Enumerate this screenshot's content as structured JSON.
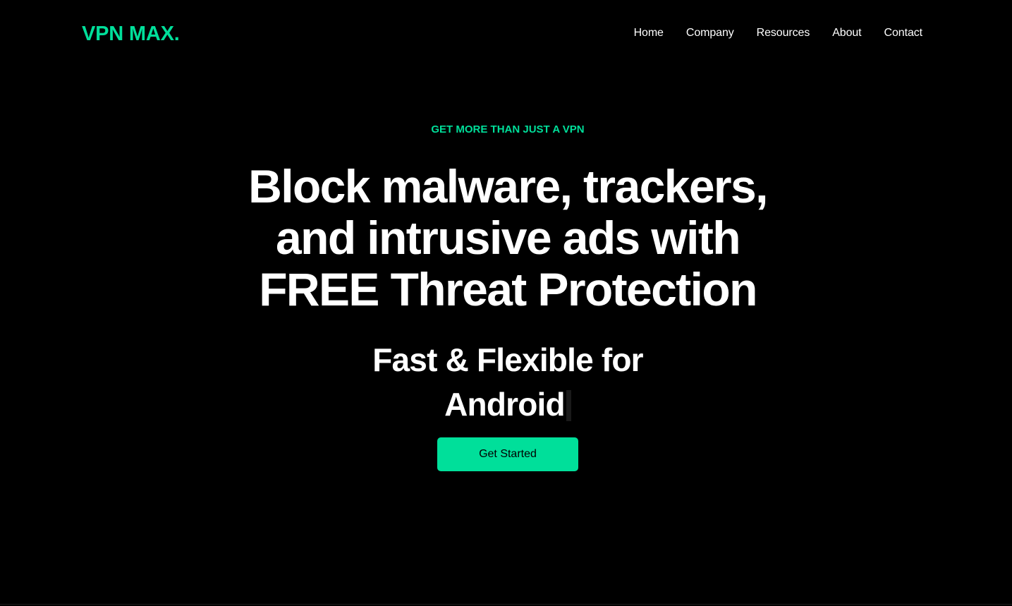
{
  "brand": {
    "logo_text": "VPN MAX.",
    "accent_color": "#00df9a",
    "background_color": "#000000"
  },
  "nav": {
    "items": [
      {
        "label": "Home"
      },
      {
        "label": "Company"
      },
      {
        "label": "Resources"
      },
      {
        "label": "About"
      },
      {
        "label": "Contact"
      }
    ]
  },
  "hero": {
    "eyebrow": "GET MORE THAN JUST A VPN",
    "headline_lines": [
      "Block malware, trackers,",
      "and intrusive ads with",
      "FREE Threat Protection"
    ],
    "subline": "Fast & Flexible for",
    "typed_word": "Android",
    "cta_label": "Get Started"
  }
}
